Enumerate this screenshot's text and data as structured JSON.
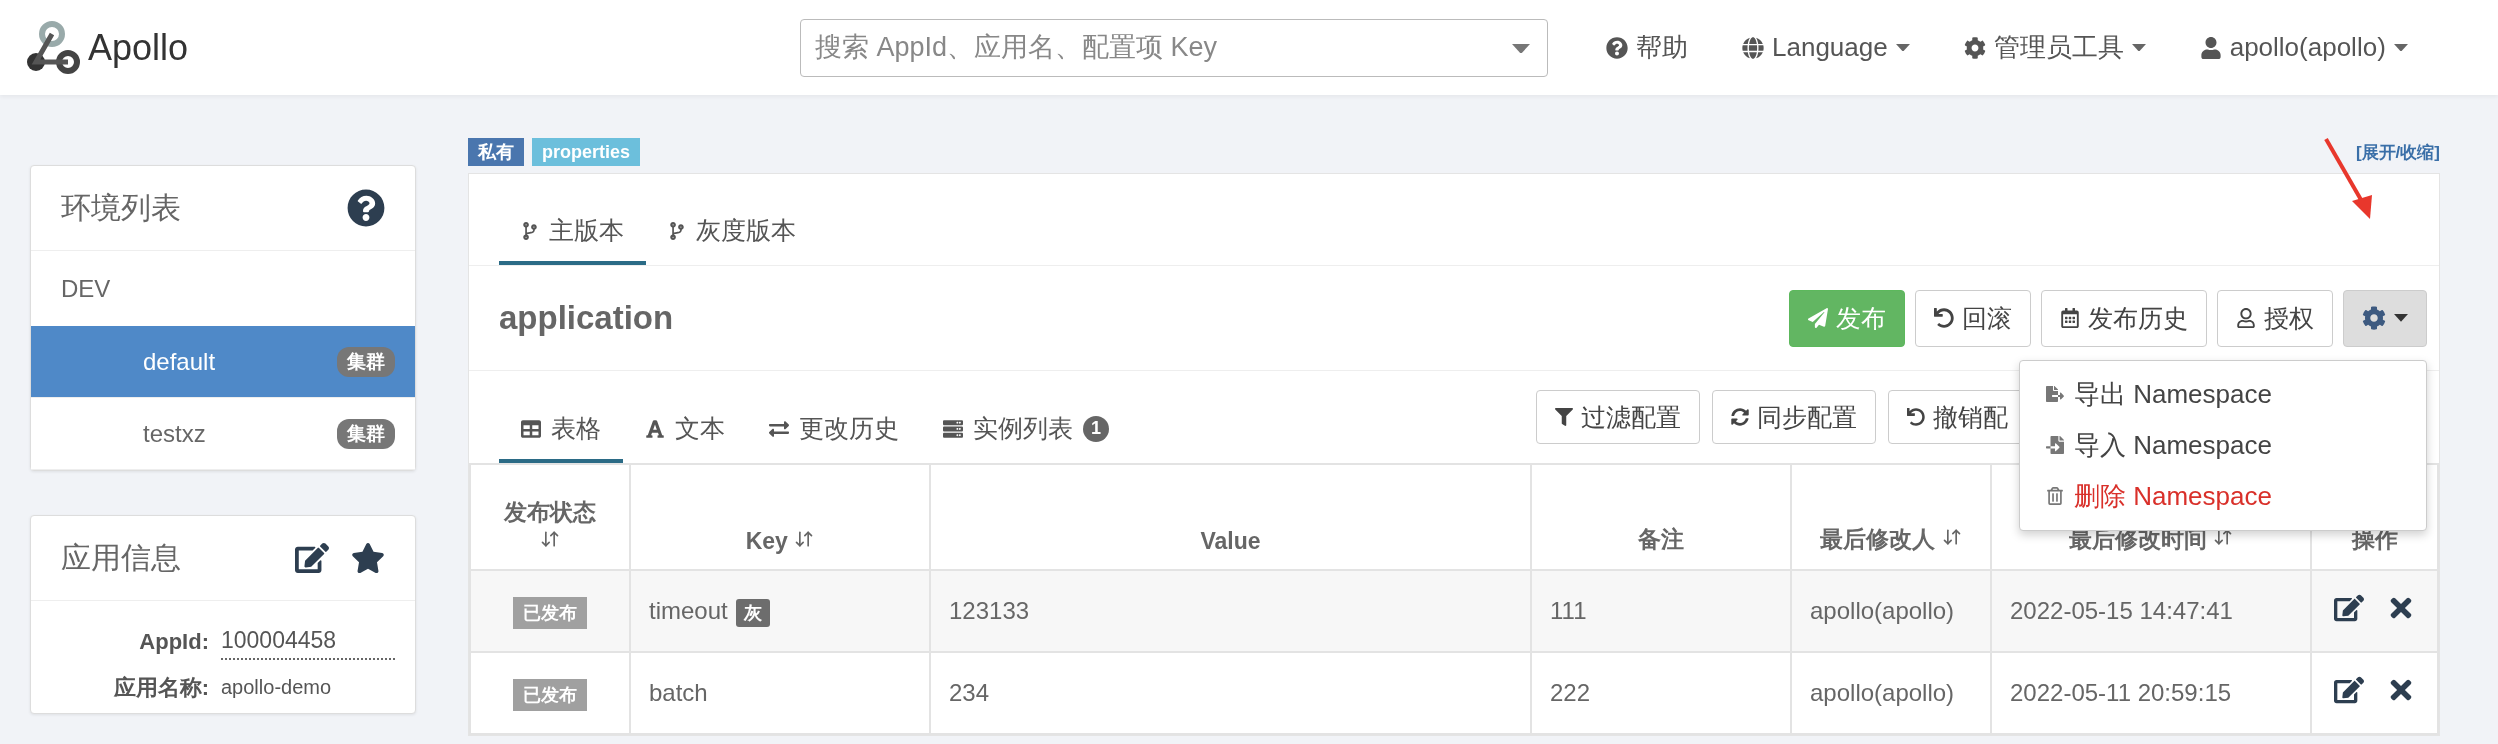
{
  "header": {
    "logo_text": "Apollo",
    "search": {
      "placeholder": "搜索 AppId、应用名、配置项 Key"
    },
    "nav": [
      {
        "kind": "help",
        "label": "帮助"
      },
      {
        "kind": "language",
        "label": "Language"
      },
      {
        "kind": "admin",
        "label": "管理员工具"
      },
      {
        "kind": "user",
        "label": "apollo(apollo)"
      }
    ]
  },
  "sidebar": {
    "env_panel": {
      "title": "环境列表",
      "envs": [
        {
          "label": "DEV",
          "children": [
            {
              "label": "default",
              "badge": "集群",
              "selected": true
            },
            {
              "label": "testxz",
              "badge": "集群",
              "selected": false
            }
          ]
        }
      ]
    },
    "app_info": {
      "title": "应用信息",
      "fields": [
        {
          "label": "AppId:",
          "value": "100004458",
          "kind": "underlined"
        },
        {
          "label": "应用名称:",
          "value": "apollo-demo",
          "kind": "plain"
        }
      ]
    }
  },
  "namespace": {
    "tags": [
      {
        "label": "私有",
        "color": "#4a76ae"
      },
      {
        "label": "properties",
        "color": "#6cbfdc"
      }
    ],
    "toggle_link": "[展开/收缩]",
    "version_tabs": [
      {
        "label": "主版本",
        "selected": true
      },
      {
        "label": "灰度版本",
        "selected": false
      }
    ],
    "name": "application",
    "actions": [
      {
        "kind": "publish",
        "label": "发布"
      },
      {
        "kind": "rollback",
        "label": "回滚"
      },
      {
        "kind": "history",
        "label": "发布历史"
      },
      {
        "kind": "grant",
        "label": "授权"
      },
      {
        "kind": "gear"
      }
    ],
    "menu": [
      {
        "kind": "export",
        "label": "导出 Namespace"
      },
      {
        "kind": "import",
        "label": "导入 Namespace"
      },
      {
        "kind": "delete",
        "label": "删除 Namespace"
      }
    ],
    "view_tabs": [
      {
        "kind": "table",
        "label": "表格",
        "selected": true
      },
      {
        "kind": "text",
        "label": "文本",
        "selected": false
      },
      {
        "kind": "history",
        "label": "更改历史",
        "selected": false
      },
      {
        "kind": "instances",
        "label": "实例列表",
        "badge": "1",
        "selected": false
      }
    ],
    "tools": [
      {
        "kind": "filter",
        "label": "过滤配置"
      },
      {
        "kind": "sync",
        "label": "同步配置"
      },
      {
        "kind": "revoke",
        "label": "撤销配"
      }
    ],
    "table": {
      "columns": [
        {
          "label": "发布状态",
          "sortable": true
        },
        {
          "label": "Key",
          "sortable": true
        },
        {
          "label": "Value",
          "sortable": false
        },
        {
          "label": "备注",
          "sortable": false
        },
        {
          "label": "最后修改人",
          "sortable": true
        },
        {
          "label": "最后修改时间",
          "sortable": true
        },
        {
          "label": "操作",
          "sortable": false
        }
      ],
      "rows": [
        {
          "status": "已发布",
          "key": "timeout",
          "gray_badge": "灰",
          "value": "123133",
          "comment": "111",
          "modifier": "apollo(apollo)",
          "time": "2022-05-15 14:47:41"
        },
        {
          "status": "已发布",
          "key": "batch",
          "value": "234",
          "comment": "222",
          "modifier": "apollo(apollo)",
          "time": "2022-05-11 20:59:15"
        }
      ]
    }
  }
}
